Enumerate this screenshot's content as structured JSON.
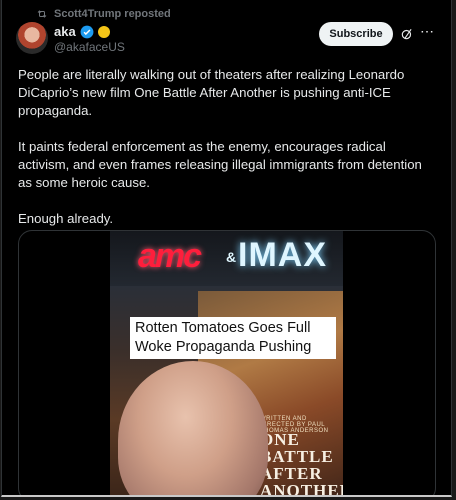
{
  "repost": {
    "text": "Scott4Trump reposted",
    "icon": "repost-icon"
  },
  "author": {
    "name": "aka",
    "handle": "@akafaceUS",
    "verified_color": "#1d9bf0",
    "subscribe_label": "Subscribe"
  },
  "tweet": {
    "paragraphs": [
      "People are literally walking out of theaters after realizing Leonardo DiCaprio’s new film One Battle After Another is pushing anti-ICE propaganda.",
      "It paints federal enforcement as the enemy, encourages radical activism, and even frames releasing illegal immigrants from detention as some heroic cause.",
      "Enough already."
    ]
  },
  "media": {
    "sign_left": "amc",
    "sign_amp": "&",
    "sign_right": "IMAX",
    "caption": "Rotten Tomatoes Goes Full Woke Propaganda Pushing",
    "poster_meta": "WRITTEN AND DIRECTED BY PAUL THOMAS ANDERSON",
    "poster_title": "ONE BATTLE AFTER ANOTHER"
  },
  "colors": {
    "accent": "#1d9bf0",
    "background": "#000000",
    "muted": "#71767b"
  }
}
